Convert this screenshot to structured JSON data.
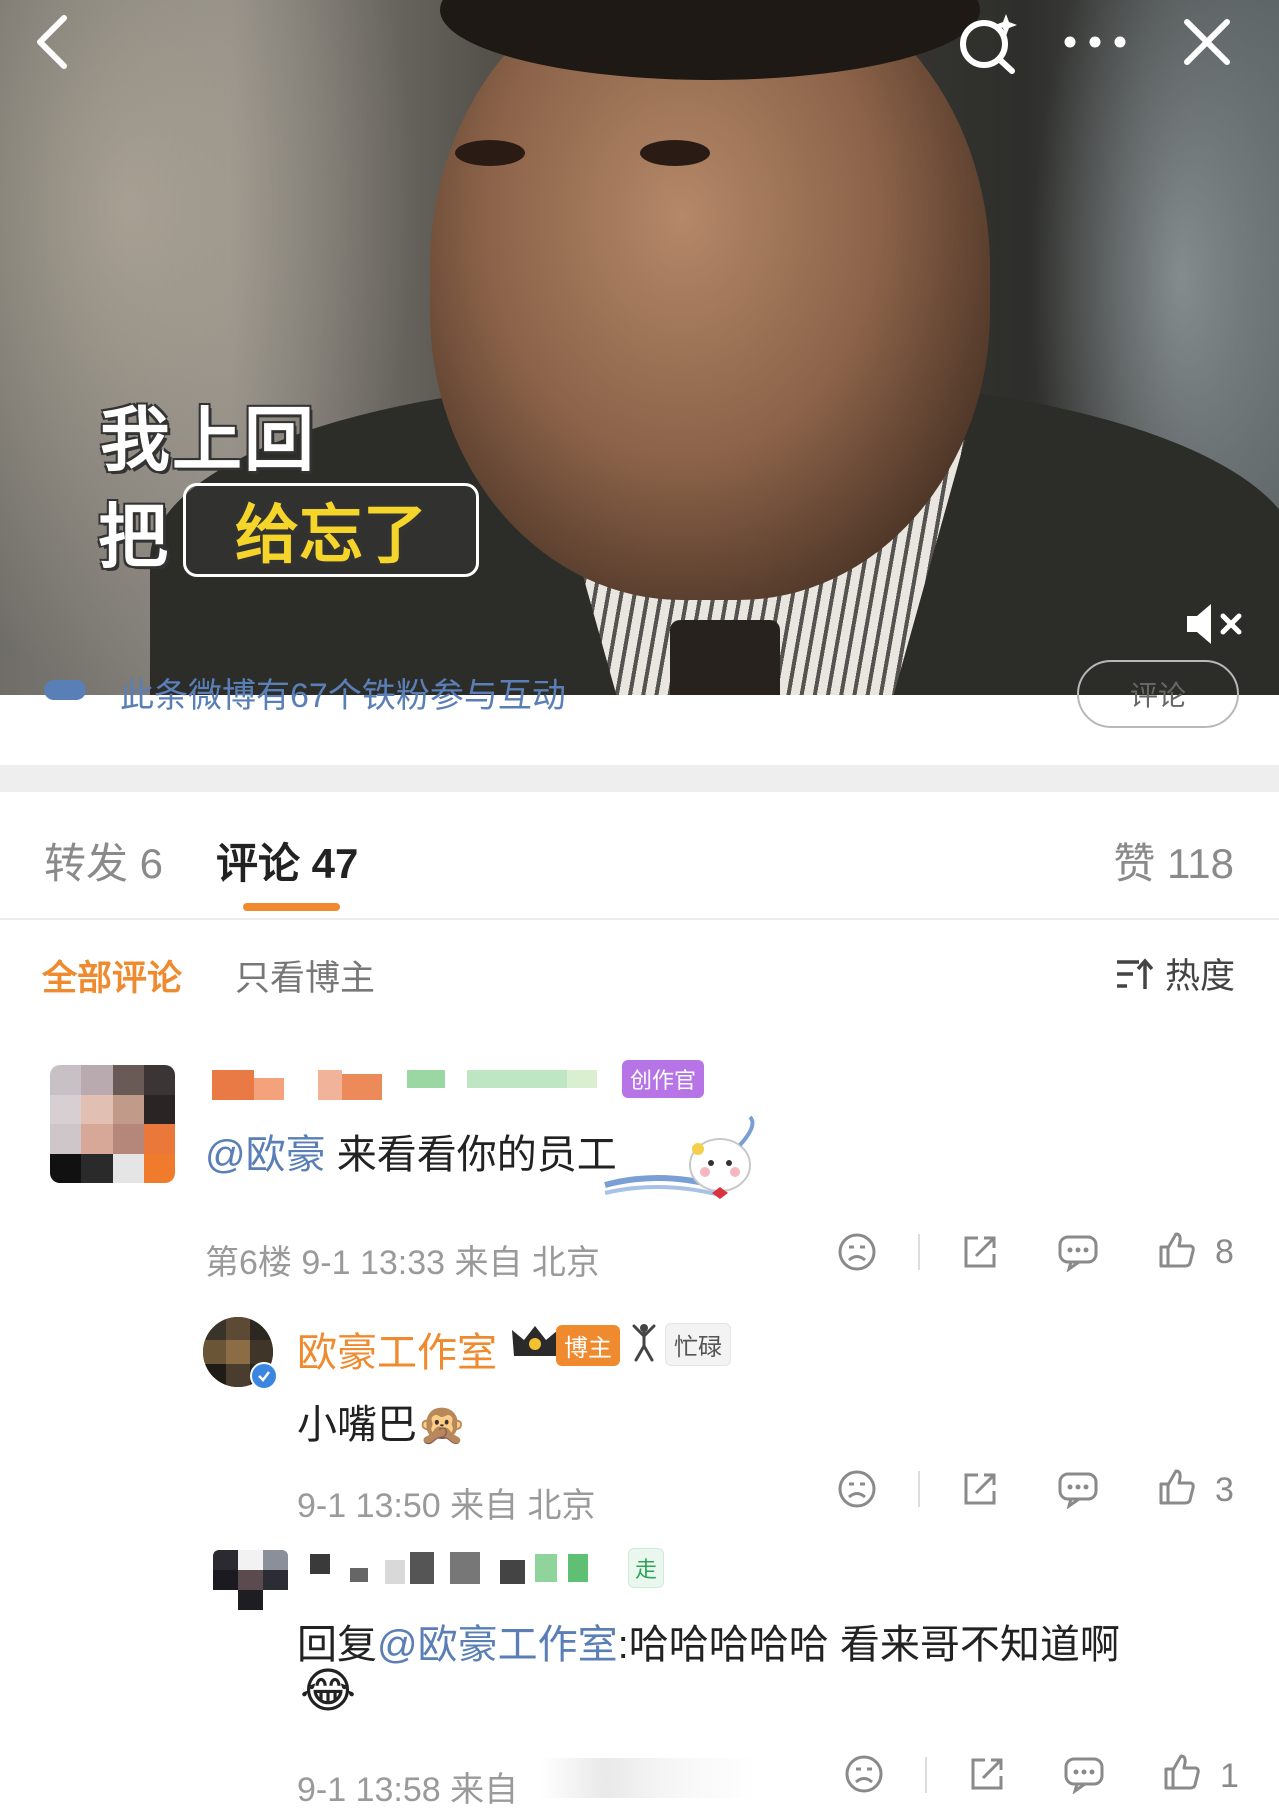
{
  "video": {
    "caption_line1": "我上回",
    "caption_line2_prefix": "把",
    "caption_highlight": "给忘了"
  },
  "nav": {
    "back_icon": "back-chevron-icon",
    "search_icon": "search-sparkle-icon",
    "more_icon": "more-dots-icon",
    "close_icon": "close-icon",
    "mute_icon": "muted-speaker-icon"
  },
  "peek": {
    "text": "此条微博有67个铁粉参与互动",
    "button": "评论"
  },
  "tabs": {
    "repost": "转发 6",
    "comments": "评论 47",
    "likes": "赞 118"
  },
  "filters": {
    "all": "全部评论",
    "author_only": "只看博主",
    "sort": "热度"
  },
  "comments": [
    {
      "badge": "创作官",
      "mention": "@欧豪",
      "text": " 来看看你的员工",
      "meta": "第6楼  9-1 13:33  来自 北京",
      "likes": "8"
    },
    {
      "name": "欧豪工作室",
      "badge_author": "博主",
      "badge_status": "忙碌",
      "text": "小嘴巴🙊",
      "meta": "9-1 13:50  来自 北京",
      "likes": "3"
    },
    {
      "badge": "走",
      "reply_prefix": "回复",
      "mention": "@欧豪工作室",
      "text": ":哈哈哈哈哈 看来哥不知道啊",
      "emoji": "😂",
      "meta": "9-1 13:58  来自",
      "likes": "1"
    }
  ],
  "colors": {
    "accent": "#f08a2e",
    "link": "#5a7fb6",
    "caption_yellow": "#f6d52b"
  }
}
